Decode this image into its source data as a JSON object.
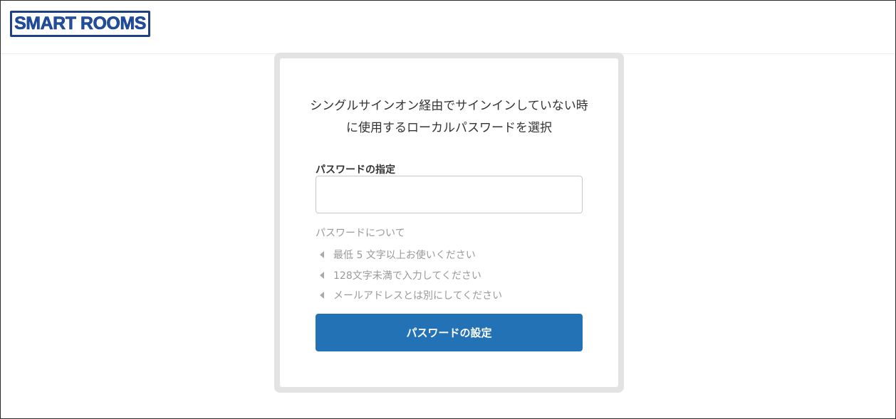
{
  "header": {
    "logo_text": "SMART ROOMS"
  },
  "card": {
    "heading_line1": "シングルサインオン経由でサインインしていない時",
    "heading_line2": "に使用するローカルパスワードを選択",
    "password_label": "パスワードの指定",
    "password_value": "",
    "password_placeholder": "",
    "about_title": "パスワードについて",
    "rules": [
      "最低 5 文字以上お使いください",
      "128文字未満で入力してください",
      "メールアドレスとは別にしてください"
    ],
    "submit_label": "パスワードの設定"
  },
  "colors": {
    "logo_navy": "#1f3f86",
    "primary_button": "#2372b6",
    "card_border": "#e3e3e3",
    "muted_text": "#999999"
  },
  "icons": {
    "rule_bullet": "caret-left-icon"
  }
}
